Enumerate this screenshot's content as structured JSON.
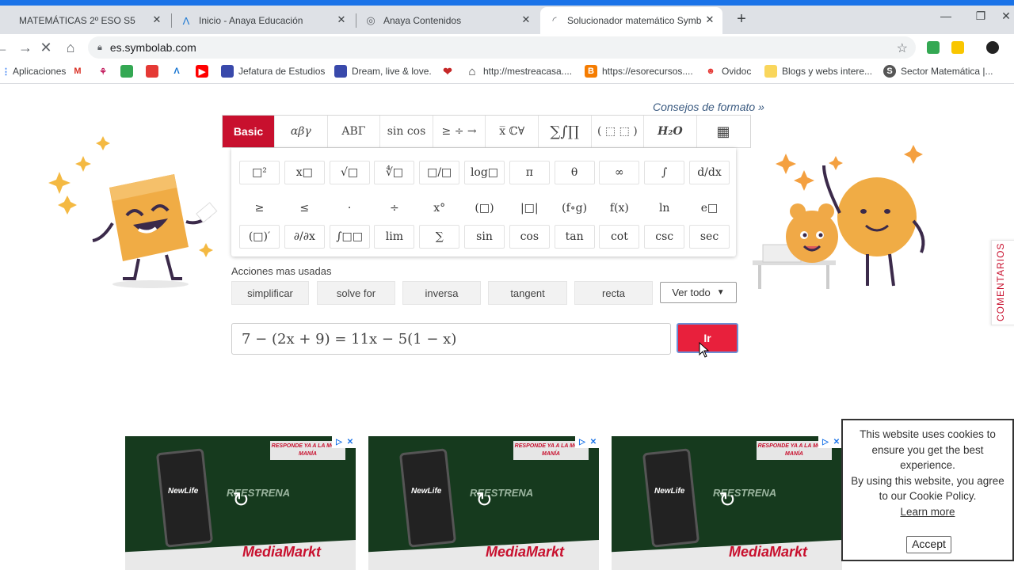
{
  "browser": {
    "tabs": [
      {
        "label": "MATEMÁTICAS 2º ESO S5",
        "icon": "document-icon"
      },
      {
        "label": "Inicio - Anaya Educación",
        "icon": "anaya-icon"
      },
      {
        "label": "Anaya Contenidos",
        "icon": "globe-icon"
      },
      {
        "label": "Solucionador matemático Symbo",
        "icon": "loading-icon"
      }
    ],
    "url": "es.symbolab.com",
    "bookmarks": [
      {
        "label": "Aplicaciones",
        "color": "#4285f4"
      },
      {
        "label": "",
        "color": "#d93025"
      },
      {
        "label": "",
        "color": "#c2185b"
      },
      {
        "label": "",
        "color": "#34a853"
      },
      {
        "label": "",
        "color": "#e53935"
      },
      {
        "label": "",
        "color": "#1976d2"
      },
      {
        "label": "",
        "color": "#ff0000"
      },
      {
        "label": "Jefatura de Estudios",
        "color": "#3949ab"
      },
      {
        "label": "Dream, live & love.",
        "color": "#3949ab"
      },
      {
        "label": "",
        "color": "#c62828"
      },
      {
        "label": "http://mestreacasa....",
        "color": "#333333"
      },
      {
        "label": "https://esorecursos....",
        "color": "#f57c00"
      },
      {
        "label": "Ovidoc",
        "color": "#e53935"
      },
      {
        "label": "Blogs y webs intere...",
        "color": "#f9a825"
      },
      {
        "label": "Sector Matemática |...",
        "color": "#555555"
      }
    ]
  },
  "solver": {
    "format_link": "Consejos de formato »",
    "keyboard_tabs": [
      "Basic",
      "αβγ",
      "ABΓ",
      "sin cos",
      "≥ ÷ →",
      "x̅ ℂ∀",
      "∑∫∏",
      "( ⬚ ⬚ )",
      "H₂O",
      "▦"
    ],
    "keys_row1": [
      "□²",
      "x□",
      "√□",
      "∜□",
      "□/□",
      "log□",
      "π",
      "θ",
      "∞",
      "∫",
      "d/dx"
    ],
    "keys_row2": [
      "≥",
      "≤",
      "·",
      "÷",
      "x°",
      "(□)",
      "|□|",
      "(f∘g)",
      "f(x)",
      "ln",
      "e□"
    ],
    "keys_row3": [
      "(□)′",
      "∂/∂x",
      "∫□□",
      "lim",
      "∑",
      "sin",
      "cos",
      "tan",
      "cot",
      "csc",
      "sec"
    ],
    "actions_title": "Acciones mas usadas",
    "actions": [
      "simplificar",
      "solve for",
      "inversa",
      "tangent",
      "recta"
    ],
    "see_all": "Ver todo",
    "expression": "7 − (2x + 9) = 11x − 5(1 − x)",
    "go_label": "Ir",
    "comments_label": "COMENTARIOS"
  },
  "ads": [
    {
      "banner": "RESPONDE YA A LA MÓVIL MANÍA",
      "headline": "REESTRENA",
      "brand": "MediaMarkt",
      "product": "NewLife"
    },
    {
      "banner": "RESPONDE YA A LA MÓVIL MANÍA",
      "headline": "REESTRENA",
      "brand": "MediaMarkt",
      "product": "NewLife"
    },
    {
      "banner": "RESPONDE YA A LA MÓVIL MANÍA",
      "headline": "REESTRENA",
      "brand": "MediaMarkt",
      "product": "NewLife"
    }
  ],
  "cookie": {
    "text1": "This website uses cookies to ensure you get the best experience.",
    "text2": "By using this website, you agree to our Cookie Policy.",
    "learn_more": "Learn more",
    "accept": "Accept"
  },
  "colors": {
    "accent": "#c8102e",
    "go_button": "#e8203c",
    "chrome_blue": "#1a73e8"
  }
}
